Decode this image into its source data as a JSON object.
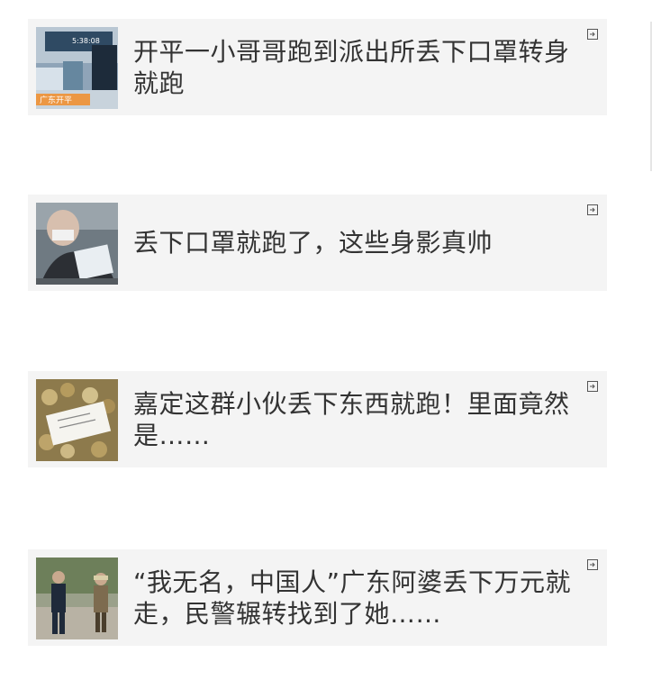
{
  "articles": [
    {
      "title": "开平一小哥哥跑到派出所丢下口罩转身就跑",
      "thumb": {
        "description": "cctv-police-station",
        "overlay_text": "广东开平",
        "timestamp": "5:38:08"
      }
    },
    {
      "title": "丢下口罩就跑了，这些身影真帅",
      "thumb": {
        "description": "cctv-masked-man"
      }
    },
    {
      "title": "嘉定这群小伙丢下东西就跑！里面竟然是……",
      "thumb": {
        "description": "coins-and-note"
      }
    },
    {
      "title": "“我无名，中国人”广东阿婆丢下万元就走，民警辗转找到了她……",
      "thumb": {
        "description": "police-and-elderly-woman"
      }
    }
  ],
  "icons": {
    "external_link": "external-link-icon"
  },
  "colors": {
    "card_bg": "#f4f4f4",
    "title_text": "#333333",
    "icon": "#555555"
  }
}
